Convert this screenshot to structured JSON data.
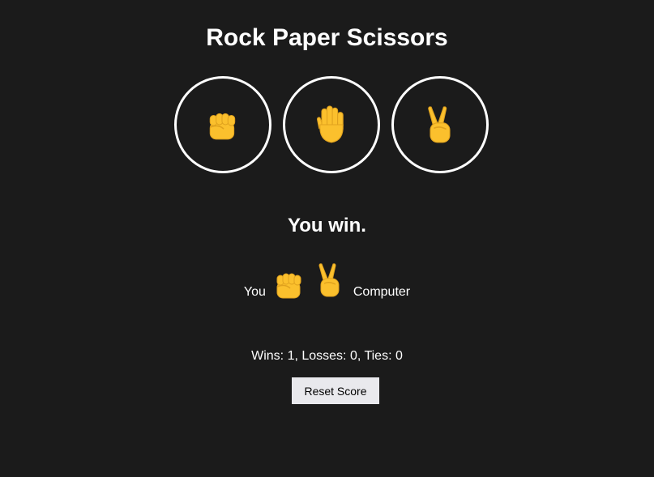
{
  "app": {
    "title": "Rock Paper Scissors"
  },
  "choices": [
    {
      "name": "rock",
      "icon": "fist-emoji"
    },
    {
      "name": "paper",
      "icon": "raised-hand-emoji"
    },
    {
      "name": "scissors",
      "icon": "victory-hand-emoji"
    }
  ],
  "result": {
    "message": "You win.",
    "player_label": "You",
    "player_move_icon": "fist-emoji",
    "computer_move_icon": "victory-hand-emoji",
    "computer_label": "Computer"
  },
  "score": {
    "text": "Wins: 1, Losses: 0, Ties: 0"
  },
  "reset_button": {
    "label": "Reset Score"
  },
  "colors": {
    "background": "#1b1b1b",
    "text": "#ffffff",
    "emoji_yellow": "#fbc02d",
    "button_bg": "#e9e9ed"
  }
}
